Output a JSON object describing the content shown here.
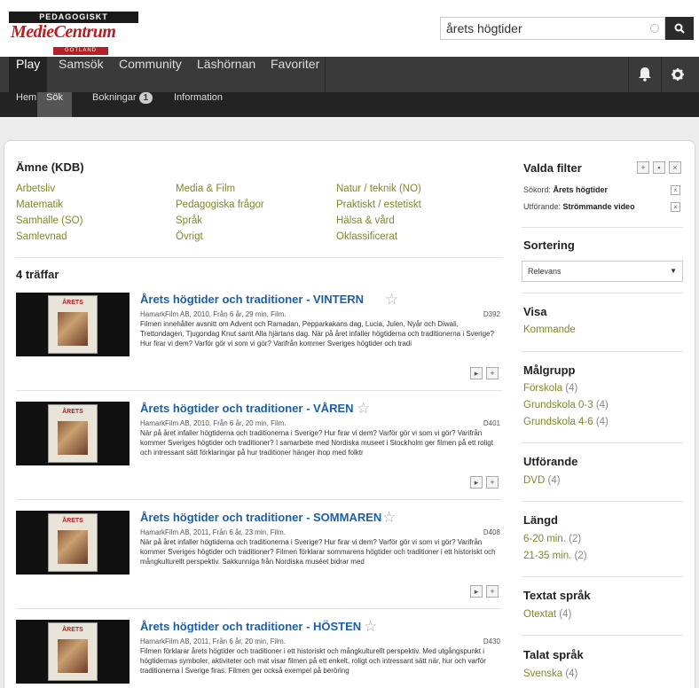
{
  "header": {
    "logo_line1": "PEDAGOGISKT",
    "logo_line2": "MedieCentrum",
    "logo_line3": "GOTLAND",
    "search_value": "årets högtider"
  },
  "main_nav": [
    "Play",
    "Samsök",
    "Community",
    "Läshörnan",
    "Favoriter"
  ],
  "sub_nav": {
    "items": [
      "Hem",
      "Sök",
      "Bokningar",
      "Information"
    ],
    "bookings_count": "1"
  },
  "subject": {
    "title": "Ämne (KDB)",
    "col1": [
      "Arbetsliv",
      "Matematik",
      "Samhälle (SO)",
      "Samlevnad"
    ],
    "col2": [
      "Media & Film",
      "Pedagogiska frågor",
      "Språk",
      "Övrigt"
    ],
    "col3": [
      "Natur / teknik (NO)",
      "Praktiskt / estetiskt",
      "Hälsa & vård",
      "Oklassificerat"
    ]
  },
  "hits_label": "4 träffar",
  "results": [
    {
      "title": "Årets högtider och traditioner - VINTERN",
      "meta": "HamarkFilm AB, 2010, Från 6 år, 29 min, Film.",
      "code": "D392",
      "desc": "Filmen innehåller avsnitt om Advent och Ramadan, Pepparkakans dag, Lucia, Julen, Nyår och Diwali, Trettondagen, Tjugondag Knut samt Alla hjärtans dag. När på året infaller högtiderna och traditionerna i Sverige? Hur firar vi dem? Varför gör vi som vi gör? Varifrån kommer Sveriges högtider och tradi",
      "cover_label": "ÅRETS"
    },
    {
      "title": "Årets högtider och traditioner - VÅREN",
      "meta": "HamarkFilm AB, 2010, Från 6 år, 20 min, Film.",
      "code": "D401",
      "desc": "När på året infaller högtiderna och traditionerna i Sverige? Hur firar vi dem? Varför gör vi som vi gör? Varifrån kommer Sveriges högtider och traditioner? I samarbete med Nordiska museet i Stockholm ger filmen på ett roligt och intressant sätt förklaringar på hur traditioner hänger ihop med folktr",
      "cover_label": "ÅRETS"
    },
    {
      "title": "Årets högtider och traditioner - SOMMAREN",
      "meta": "HamarkFilm AB, 2011, Från 6 år, 23 min, Film.",
      "code": "D408",
      "desc": "När på året infaller högtiderna och traditionerna i Sverige? Hur firar vi dem? Varför gör vi som vi gör? Varifrån kommer Sveriges högtider och traditioner? Filmen förklarar sommarens högtider och traditioner i ett historiskt och mångkulturellt perspektiv. Sakkunniga från Nordiska muséet bidrar med",
      "cover_label": "ÅRETS"
    },
    {
      "title": "Årets högtider och traditioner - HÖSTEN",
      "meta": "HamarkFilm AB, 2011, Från 6 år, 20 min, Film.",
      "code": "D430",
      "desc": "Filmen förklarar årets högtider och traditioner i ett historiskt och mångkulturellt perspektiv. Med utgångspunkt i högtidernas symboler, aktiviteter och mat visar filmen på ett enkelt, roligt och intressant sätt när, hur och varför traditionerna i Sverige firas. Filmen ger också exempel på beröring",
      "cover_label": "ÅRETS"
    }
  ],
  "sidebar": {
    "selected_filters_title": "Valda filter",
    "filter1_label": "Sökord:",
    "filter1_value": "Årets högtider",
    "filter2_label": "Utförande:",
    "filter2_value": "Strömmande video",
    "sort_title": "Sortering",
    "sort_value": "Relevans",
    "show_title": "Visa",
    "show_link": "Kommande",
    "target_title": "Målgrupp",
    "target_items": [
      {
        "label": "Förskola",
        "count": "(4)"
      },
      {
        "label": "Grundskola 0-3",
        "count": "(4)"
      },
      {
        "label": "Grundskola 4-6",
        "count": "(4)"
      }
    ],
    "format_title": "Utförande",
    "format_items": [
      {
        "label": "DVD",
        "count": "(4)"
      }
    ],
    "length_title": "Längd",
    "length_items": [
      {
        "label": "6-20 min.",
        "count": "(2)"
      },
      {
        "label": "21-35 min.",
        "count": "(2)"
      }
    ],
    "text_lang_title": "Textat språk",
    "text_lang_items": [
      {
        "label": "Otextat",
        "count": "(4)"
      }
    ],
    "spoken_lang_title": "Talat språk",
    "spoken_lang_items": [
      {
        "label": "Svenska",
        "count": "(4)"
      }
    ]
  }
}
